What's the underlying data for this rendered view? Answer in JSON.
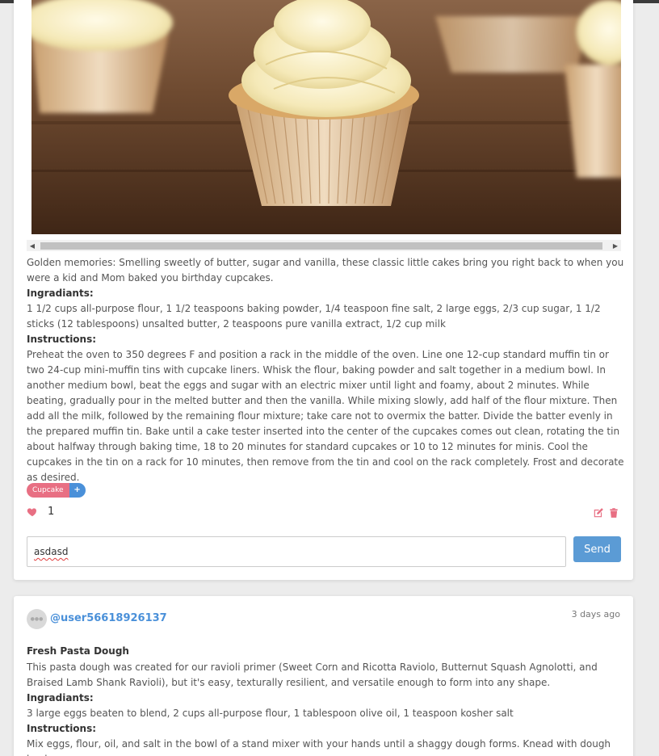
{
  "post1": {
    "description": "Golden memories: Smelling sweetly of butter, sugar and vanilla, these classic little cakes bring you right back to when you were a kid and Mom baked you birthday cupcakes.",
    "ingredients_label": "Ingradiants:",
    "ingredients": "1 1/2 cups all-purpose flour, 1 1/2 teaspoons baking powder, 1/4 teaspoon fine salt, 2 large eggs, 2/3 cup sugar, 1 1/2 sticks (12 tablespoons) unsalted butter, 2 teaspoons pure vanilla extract, 1/2 cup milk",
    "instructions_label": "Instructions:",
    "instructions": "Preheat the oven to 350 degrees F and position a rack in the middle of the oven. Line one 12-cup standard muffin tin or two 24-cup mini-muffin tins with cupcake liners. Whisk the flour, baking powder and salt together in a medium bowl. In another medium bowl, beat the eggs and sugar with an electric mixer until light and foamy, about 2 minutes. While beating, gradually pour in the melted butter and then the vanilla. While mixing slowly, add half of the flour mixture. Then add all the milk, followed by the remaining flour mixture; take care not to overmix the batter. Divide the batter evenly in the prepared muffin tin. Bake until a cake tester inserted into the center of the cupcakes comes out clean, rotating the tin about halfway through baking time, 18 to 20 minutes for standard cupcakes or 10 to 12 minutes for minis. Cool the cupcakes in the tin on a rack for 10 minutes, then remove from the tin and cool on the rack completely. Frost and decorate as desired.",
    "tag": "Cupcake",
    "tag_add": "+",
    "likes": "1",
    "comment_value": "asdasd",
    "send_label": "Send"
  },
  "post2": {
    "username": "@user56618926137",
    "timestamp": "3 days ago",
    "title": "Fresh Pasta Dough",
    "description": "This pasta dough was created for our ravioli primer (Sweet Corn and Ricotta Raviolo, Butternut Squash Agnolotti, and Braised Lamb Shank Ravioli), but it's easy, texturally resilient, and versatile enough to form into any shape.",
    "ingredients_label": "Ingradiants:",
    "ingredients": "3 large eggs beaten to blend, 2 cups all-purpose flour, 1 tablespoon olive oil, 1 teaspoon kosher salt",
    "instructions_label": "Instructions:",
    "instructions": "Mix eggs, flour, oil, and salt in the bowl of a stand mixer with your hands until a shaggy dough forms. Knead with dough hook"
  },
  "colors": {
    "accent": "#4a90d9",
    "tag": "#e86f83",
    "like": "#e86f83",
    "send": "#5b9bd5"
  },
  "icons": {
    "like": "heart-icon",
    "edit": "edit-icon",
    "delete": "trash-icon",
    "scroll_left": "arrow-left-icon",
    "scroll_right": "arrow-right-icon"
  }
}
